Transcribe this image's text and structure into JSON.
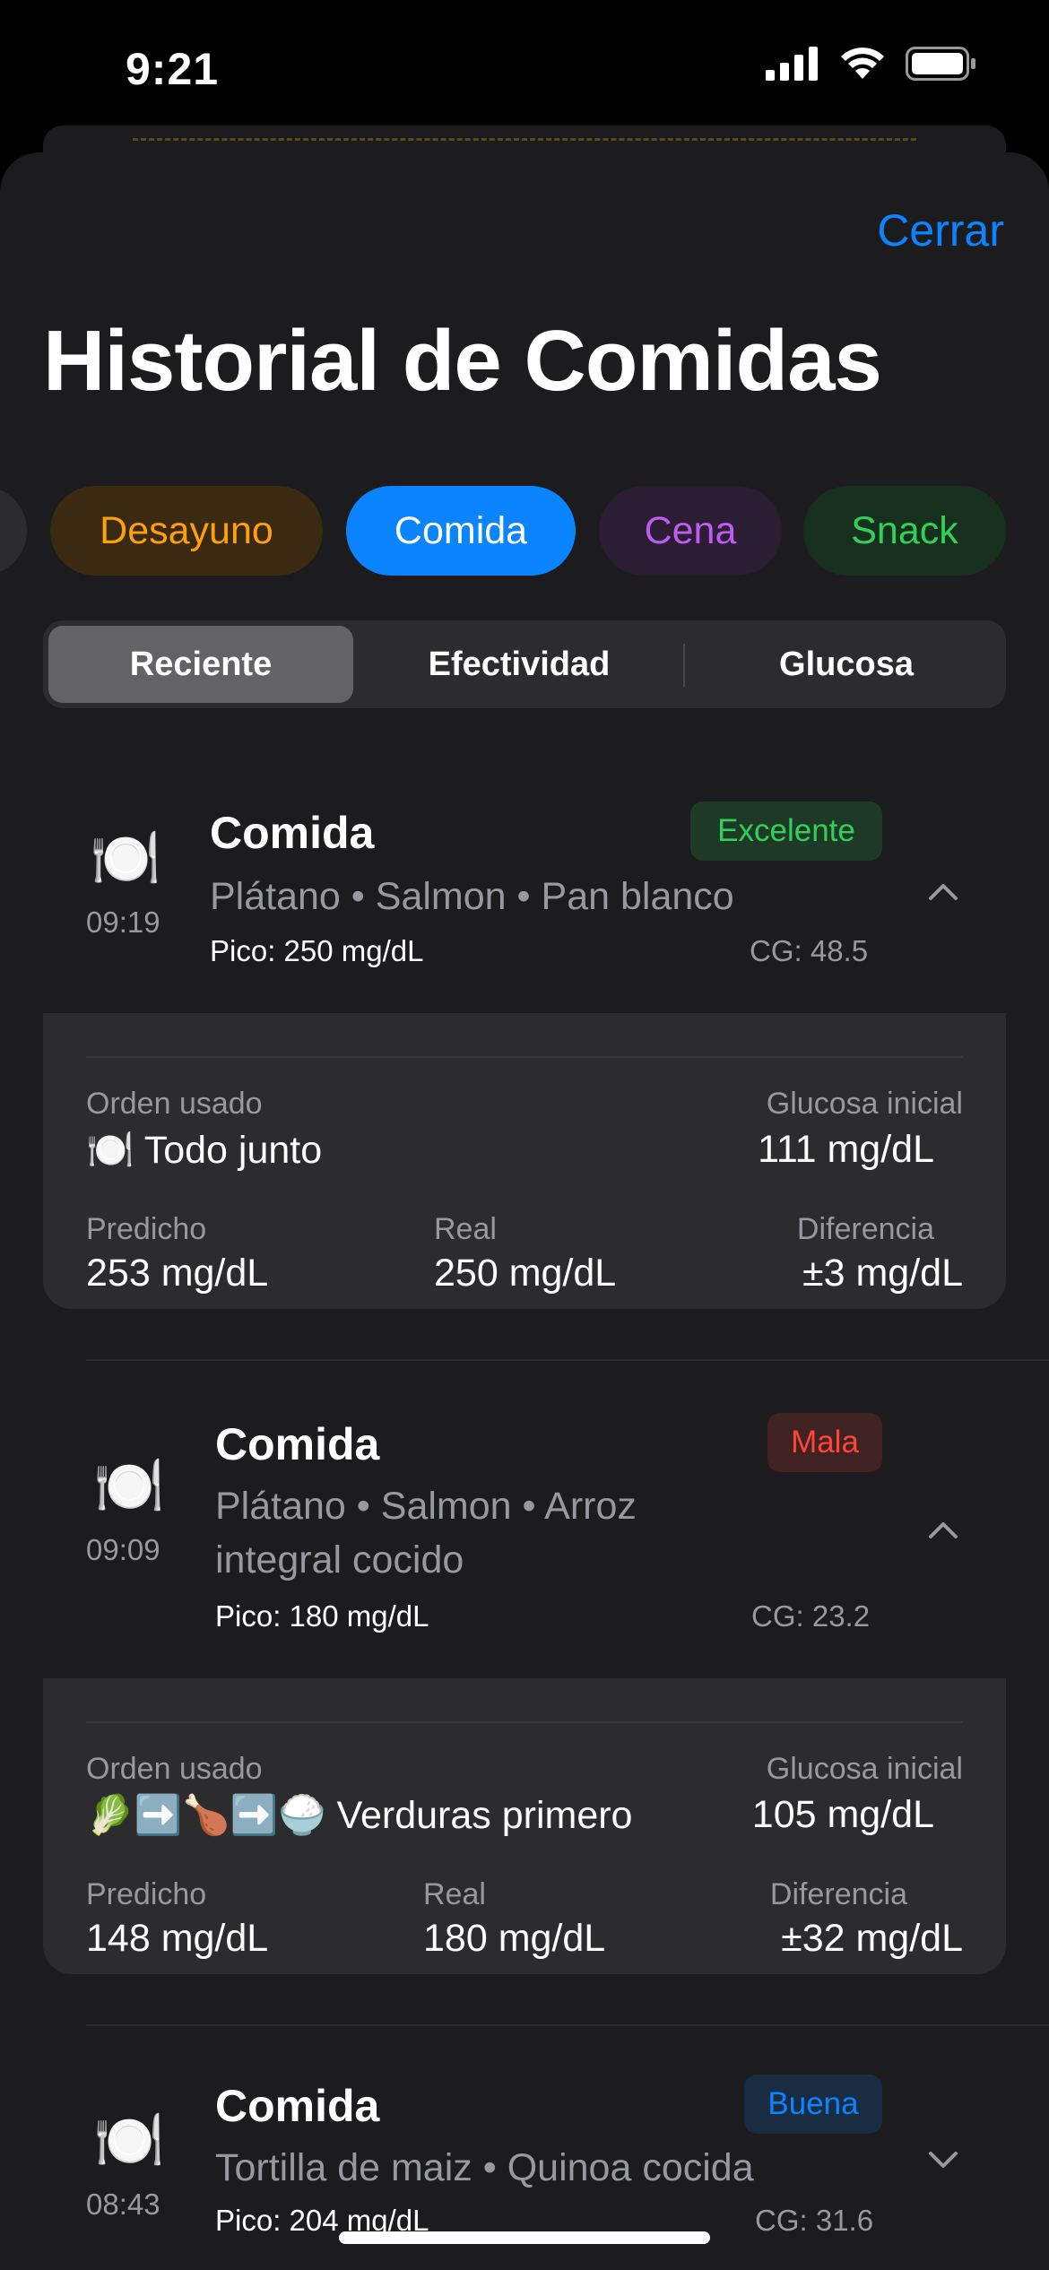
{
  "status_bar": {
    "time": "9:21"
  },
  "sheet": {
    "close_label": "Cerrar",
    "title": "Historial de Comidas"
  },
  "filters": {
    "categories": [
      {
        "label": "Desayuno",
        "color": "#ff9f0a",
        "bg": "#3a2a12"
      },
      {
        "label": "Comida",
        "color": "#ffffff",
        "bg": "#0a84ff",
        "selected": true
      },
      {
        "label": "Cena",
        "color": "#bf5af2",
        "bg": "#2b1d33"
      },
      {
        "label": "Snack",
        "color": "#30d158",
        "bg": "#17301d"
      }
    ]
  },
  "segmented": {
    "options": [
      "Reciente",
      "Efectividad",
      "Glucosa"
    ],
    "selected": "Reciente"
  },
  "meals": [
    {
      "icon": "fork-knife-plate-icon",
      "time": "09:19",
      "name": "Comida",
      "badge": "Excelente",
      "badge_color": "#30d158",
      "foods": "Plátano • Salmon • Pan blanco",
      "peak": "Pico: 250 mg/dL",
      "cg": "CG: 48.5",
      "expanded": true,
      "detail": {
        "order_label": "Orden usado",
        "order_icons": "🍽️",
        "order_value": "Todo junto",
        "initial_label": "Glucosa inicial",
        "initial_value": "111 mg/dL",
        "predicted_label": "Predicho",
        "predicted_value": "253 mg/dL",
        "real_label": "Real",
        "real_value": "250 mg/dL",
        "diff_label": "Diferencia",
        "diff_value": "±3 mg/dL"
      }
    },
    {
      "icon": "fork-knife-plate-icon",
      "time": "09:09",
      "name": "Comida",
      "badge": "Mala",
      "badge_color": "#ff453a",
      "foods_line1": "Plátano • Salmon • Arroz",
      "foods_line2": "integral cocido",
      "peak": "Pico: 180 mg/dL",
      "cg": "CG: 23.2",
      "expanded": true,
      "detail": {
        "order_label": "Orden usado",
        "order_icons": "🥬➡️🍗➡️🍚",
        "order_value": "Verduras primero",
        "initial_label": "Glucosa inicial",
        "initial_value": "105 mg/dL",
        "predicted_label": "Predicho",
        "predicted_value": "148 mg/dL",
        "real_label": "Real",
        "real_value": "180 mg/dL",
        "diff_label": "Diferencia",
        "diff_value": "±32 mg/dL"
      }
    },
    {
      "icon": "fork-knife-plate-icon",
      "time": "08:43",
      "name": "Comida",
      "badge": "Buena",
      "badge_color": "#0a84ff",
      "foods": "Tortilla de maiz • Quinoa cocida",
      "peak": "Pico: 204 mg/dL",
      "cg": "CG: 31.6",
      "expanded": false
    }
  ]
}
